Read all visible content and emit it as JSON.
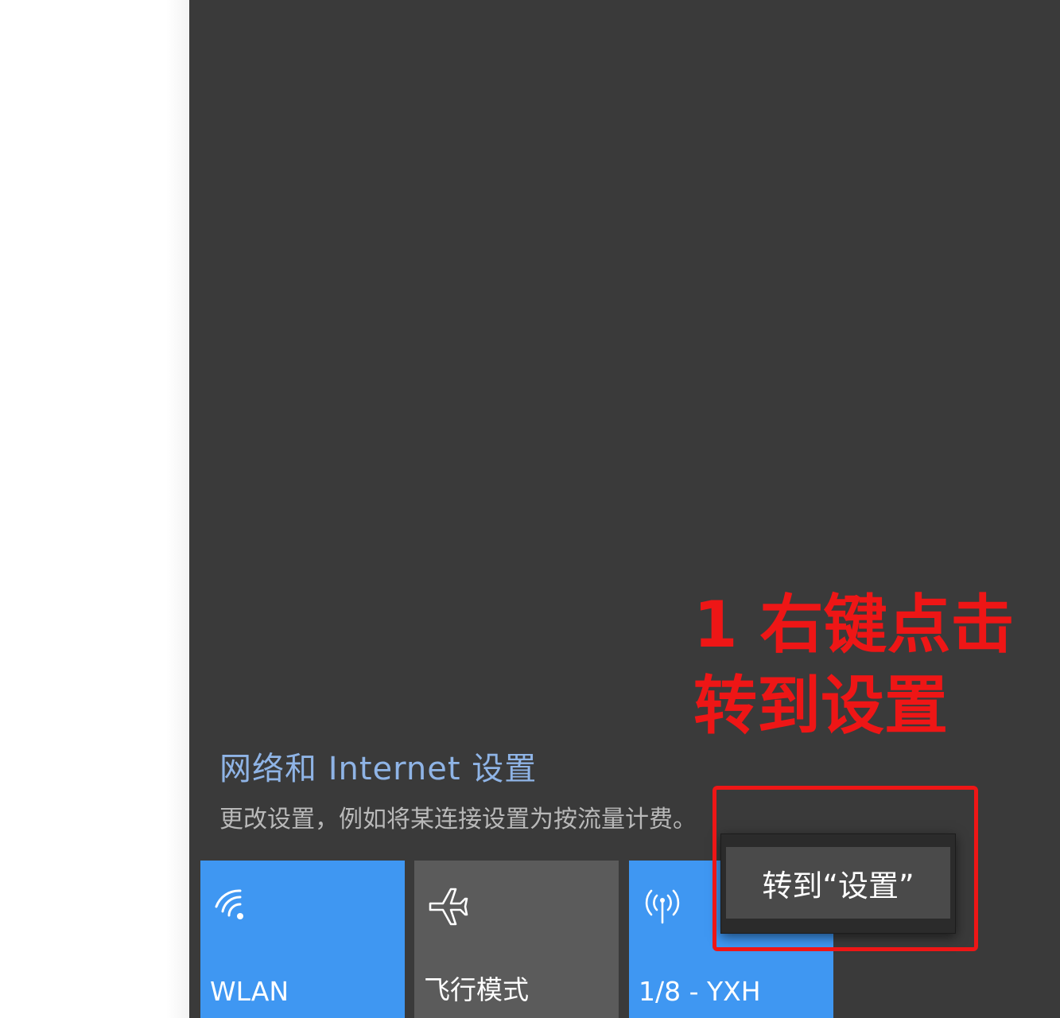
{
  "network_settings": {
    "title": "网络和 Internet 设置",
    "description": "更改设置，例如将某连接设置为按流量计费。"
  },
  "quick_actions": [
    {
      "label": "WLAN",
      "icon": "wifi-icon",
      "state": "on"
    },
    {
      "label": "飞行模式",
      "icon": "airplane-icon",
      "state": "off"
    },
    {
      "label": "1/8 - YXH",
      "icon": "mobile-hotspot-icon",
      "state": "on"
    }
  ],
  "context_menu": {
    "item_label": "转到“设置”"
  },
  "annotation": {
    "line1": "1 右键点击",
    "line2": "转到设置",
    "color": "#ee1616"
  },
  "colors": {
    "panel_bg": "#3a3a3a",
    "tile_on": "#3f97f2",
    "tile_off": "#5b5b5b",
    "link": "#8fb4e6"
  }
}
